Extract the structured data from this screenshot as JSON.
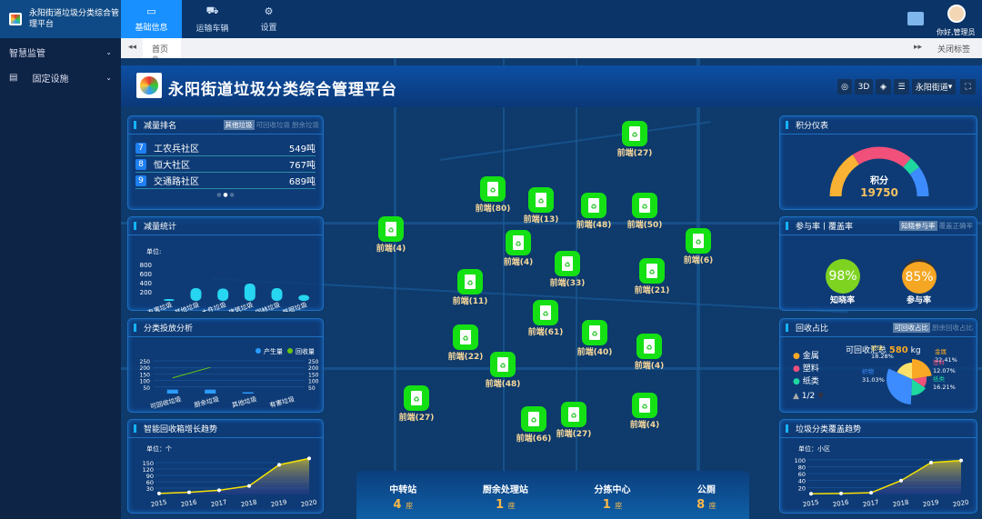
{
  "app": {
    "title": "永阳街道垃圾分类综合管理平台",
    "user_greeting": "你好,管理员"
  },
  "nav": {
    "tabs": [
      {
        "label": "基础信息",
        "icon": "message-icon"
      },
      {
        "label": "运输车辆",
        "icon": "truck-icon"
      },
      {
        "label": "设置",
        "icon": "gear-icon"
      }
    ]
  },
  "sidebar": {
    "items": [
      {
        "label": "智慧监管"
      },
      {
        "label": "固定设施"
      }
    ]
  },
  "tabsbar": {
    "home": "首页",
    "close_tabs": "关闭标签"
  },
  "dashboard": {
    "title": "永阳街道垃圾分类综合管理平台",
    "toolbar": {
      "btn_3d": "3D",
      "district": "永阳街道"
    }
  },
  "reduction_rank": {
    "title": "减量排名",
    "tabs": [
      "其他垃圾",
      "可回收垃圾",
      "厨余垃圾"
    ],
    "rows": [
      {
        "rank": "7",
        "name": "工农兵社区",
        "value": "549吨"
      },
      {
        "rank": "8",
        "name": "恒大社区",
        "value": "767吨"
      },
      {
        "rank": "9",
        "name": "交通路社区",
        "value": "689吨"
      }
    ]
  },
  "chart_data": [
    {
      "type": "bar",
      "title": "减量统计",
      "ylabel": "单位:",
      "categories": [
        "有害垃圾",
        "其他垃圾",
        "大件垃圾",
        "建筑垃圾",
        "园林垃圾",
        "餐厨垃圾"
      ],
      "values": [
        40,
        280,
        270,
        380,
        280,
        130
      ],
      "yticks": [
        200,
        400,
        600,
        800
      ],
      "ylim": [
        0,
        800
      ]
    },
    {
      "type": "bar",
      "title": "分类投放分析",
      "legend": [
        "产生量",
        "回收量"
      ],
      "categories": [
        "可回收垃圾",
        "厨余垃圾",
        "其他垃圾",
        "有害垃圾"
      ],
      "series": [
        {
          "name": "产生量",
          "values": [
            30,
            30,
            10,
            0
          ]
        },
        {
          "name": "回收量",
          "values": [
            120,
            200,
            null,
            null
          ]
        }
      ],
      "yticks": [
        50,
        100,
        150,
        200,
        250
      ],
      "ylim": [
        0,
        250
      ]
    },
    {
      "type": "area",
      "title": "智能回收箱增长趋势",
      "ylabel": "单位：个",
      "categories": [
        "2015",
        "2016",
        "2017",
        "2018",
        "2019",
        "2020"
      ],
      "values": [
        5,
        10,
        20,
        40,
        140,
        170
      ],
      "yticks": [
        30,
        60,
        90,
        120,
        150
      ],
      "ylim": [
        0,
        180
      ]
    },
    {
      "type": "gauge",
      "title": "积分仪表",
      "label": "积分",
      "value": "19750"
    },
    {
      "type": "pie",
      "title": "回收占比",
      "tabs": [
        "可回收占比",
        "厨余回收占比"
      ],
      "total_label": "可回收汇总",
      "total": "580",
      "unit": "kg",
      "legend": [
        "金属",
        "塑料",
        "纸类"
      ],
      "page": "1/2",
      "slices": [
        {
          "name": "金属",
          "value": 22.41,
          "color": "#f9a825"
        },
        {
          "name": "塑料",
          "value": 12.07,
          "color": "#f0507a"
        },
        {
          "name": "纸类",
          "value": 16.21,
          "color": "#1ed8a0"
        },
        {
          "name": "织物",
          "value": 31.03,
          "color": "#3d8cff"
        },
        {
          "name": "玻璃",
          "value": 18.28,
          "color": "#fde26a"
        }
      ]
    },
    {
      "type": "area",
      "title": "垃圾分类覆盖趋势",
      "ylabel": "单位：小区",
      "categories": [
        "2015",
        "2016",
        "2017",
        "2018",
        "2019",
        "2020"
      ],
      "values": [
        2,
        3,
        5,
        40,
        92,
        98
      ],
      "yticks": [
        20,
        40,
        60,
        80,
        100
      ],
      "ylim": [
        0,
        110
      ]
    }
  ],
  "rates": {
    "title": "参与率丨覆盖率",
    "tabs": [
      "知晓参与率",
      "覆盖正确率"
    ],
    "items": [
      {
        "value": "98%",
        "label": "知晓率",
        "color": "#7ed321"
      },
      {
        "value": "85%",
        "label": "参与率",
        "color": "#f5a623"
      }
    ]
  },
  "map": {
    "markers": [
      "前端(27)",
      "前端(80)",
      "前端(13)",
      "前端(48)",
      "前端(50)",
      "前端(4)",
      "前端(4)",
      "前端(6)",
      "前端(33)",
      "前端(11)",
      "前端(21)",
      "前端(61)",
      "前端(22)",
      "前端(40)",
      "前端(4)",
      "前端(48)",
      "前端(27)",
      "前端(66)",
      "前端(27)",
      "前端(4)"
    ]
  },
  "facilities": [
    {
      "name": "中转站",
      "count": "4",
      "unit": "座"
    },
    {
      "name": "厨余处理站",
      "count": "1",
      "unit": "座"
    },
    {
      "name": "分拣中心",
      "count": "1",
      "unit": "座"
    },
    {
      "name": "公厕",
      "count": "8",
      "unit": "座"
    }
  ]
}
